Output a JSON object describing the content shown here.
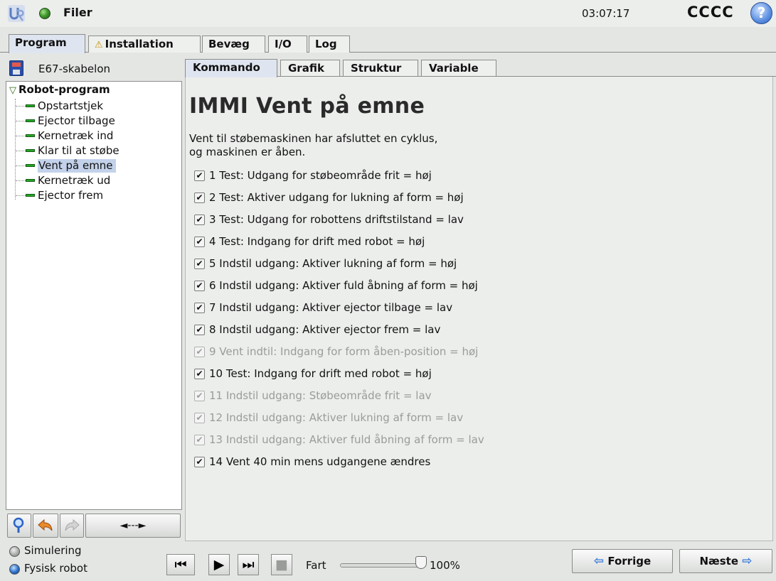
{
  "header": {
    "files_label": "Filer",
    "clock": "03:07:17",
    "robot_name": "CCCC",
    "help_glyph": "?"
  },
  "main_tabs": [
    {
      "label": "Program",
      "active": true
    },
    {
      "label": "Installation",
      "warning": true
    },
    {
      "label": "Bevæg"
    },
    {
      "label": "I/O"
    },
    {
      "label": "Log"
    }
  ],
  "program": {
    "file_name": "E67-skabelon",
    "tree": {
      "root": "Robot-program",
      "items": [
        {
          "label": "Opstartstjek"
        },
        {
          "label": "Ejector tilbage"
        },
        {
          "label": "Kernetræk ind"
        },
        {
          "label": "Klar til at støbe"
        },
        {
          "label": "Vent på emne",
          "selected": true
        },
        {
          "label": "Kernetræk ud"
        },
        {
          "label": "Ejector frem"
        }
      ]
    },
    "toolbar": {
      "search_icon": "magnifier-icon",
      "undo_icon": "undo-arrow-icon",
      "redo_icon": "redo-arrow-icon",
      "move_label": "◄---►"
    }
  },
  "sub_tabs": [
    {
      "label": "Kommando",
      "active": true
    },
    {
      "label": "Grafik"
    },
    {
      "label": "Struktur"
    },
    {
      "label": "Variable"
    }
  ],
  "command": {
    "title": "IMMI Vent på emne",
    "description_line1": "Vent til støbemaskinen har afsluttet en cyklus,",
    "description_line2": "og maskinen er åben.",
    "checks": [
      {
        "text": "1 Test: Udgang for støbeområde frit = høj",
        "checked": true,
        "enabled": true
      },
      {
        "text": "2 Test: Aktiver udgang for lukning af form = høj",
        "checked": true,
        "enabled": true
      },
      {
        "text": "3 Test: Udgang for robottens driftstilstand = lav",
        "checked": true,
        "enabled": true
      },
      {
        "text": "4 Test: Indgang for drift med robot = høj",
        "checked": true,
        "enabled": true
      },
      {
        "text": "5 Indstil udgang: Aktiver lukning af form = høj",
        "checked": true,
        "enabled": true
      },
      {
        "text": "6 Indstil udgang: Aktiver fuld åbning af form = høj",
        "checked": true,
        "enabled": true
      },
      {
        "text": "7 Indstil udgang: Aktiver ejector tilbage = lav",
        "checked": true,
        "enabled": true
      },
      {
        "text": "8 Indstil udgang: Aktiver ejector frem = lav",
        "checked": true,
        "enabled": true
      },
      {
        "text": "9 Vent indtil: Indgang for form åben-position = høj",
        "checked": true,
        "enabled": false
      },
      {
        "text": "10 Test: Indgang for drift med robot = høj",
        "checked": true,
        "enabled": true
      },
      {
        "text": "11 Indstil udgang: Støbeområde frit = lav",
        "checked": true,
        "enabled": false
      },
      {
        "text": "12 Indstil udgang: Aktiver lukning af form = lav",
        "checked": true,
        "enabled": false
      },
      {
        "text": "13 Indstil udgang: Aktiver fuld åbning af form = lav",
        "checked": true,
        "enabled": false
      },
      {
        "text": "14 Vent 40 min mens udgangene ændres",
        "checked": true,
        "enabled": true
      }
    ]
  },
  "footer": {
    "mode_simulation": "Simulering",
    "mode_physical": "Fysisk robot",
    "selected_mode": "Fysisk robot",
    "speed_label": "Fart",
    "speed_value": "100%",
    "speed_fraction": 1.0,
    "prev_label": "Forrige",
    "next_label": "Næste"
  }
}
